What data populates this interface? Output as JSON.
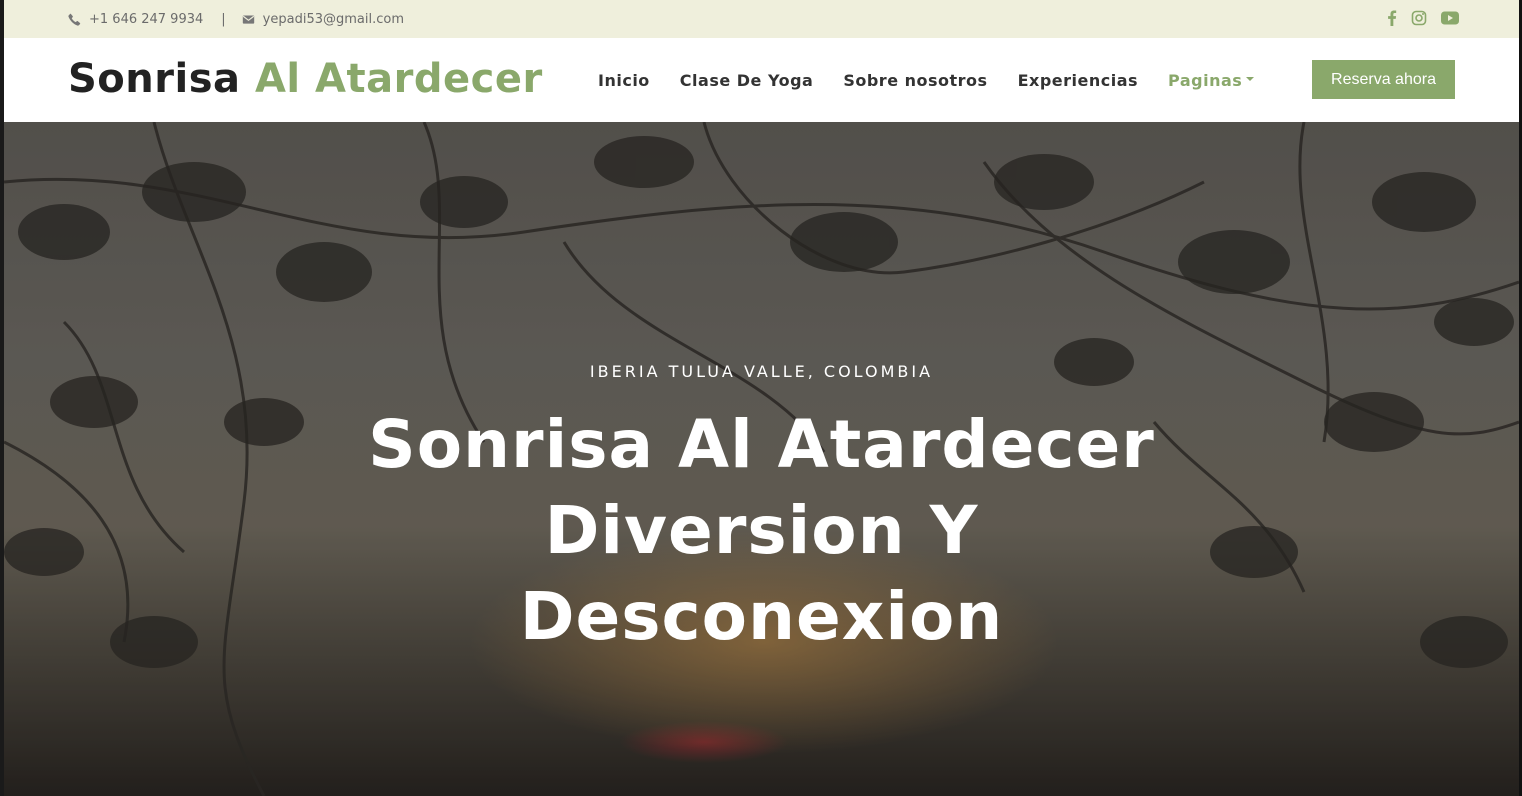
{
  "topbar": {
    "phone": "+1 646 247 9934",
    "separator": "|",
    "email": "yepadi53@gmail.com",
    "social": [
      "facebook-icon",
      "instagram-icon",
      "youtube-icon"
    ]
  },
  "header": {
    "logo_dark": "Sonrisa",
    "logo_green": "Al Atardecer",
    "nav": [
      {
        "label": "Inicio"
      },
      {
        "label": "Clase De Yoga"
      },
      {
        "label": "Sobre nosotros"
      },
      {
        "label": "Experiencias"
      },
      {
        "label": "Paginas"
      }
    ],
    "cta": "Reserva ahora"
  },
  "hero": {
    "location": "IBERIA TULUA VALLE, COLOMBIA",
    "title_line1": "Sonrisa Al Atardecer",
    "title_line2": "Diversion Y",
    "title_line3": "Desconexion"
  },
  "colors": {
    "accent": "#8aa86b",
    "topbar_bg": "#efefdc",
    "text_dark": "#222222"
  }
}
